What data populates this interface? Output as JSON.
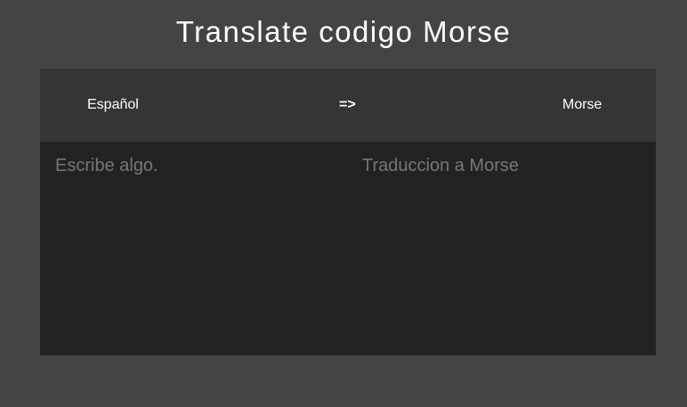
{
  "header": {
    "title": "Translate codigo Morse"
  },
  "lang_bar": {
    "source_label": "Español",
    "swap_label": "=>",
    "target_label": "Morse"
  },
  "input": {
    "value": "",
    "placeholder": "Escribe algo."
  },
  "output": {
    "value": "",
    "placeholder": "Traduccion a Morse"
  },
  "colors": {
    "page_background": "#444444",
    "panel_background": "#222222",
    "bar_background": "#353535",
    "text": "#ffffff",
    "placeholder": "#777777"
  }
}
